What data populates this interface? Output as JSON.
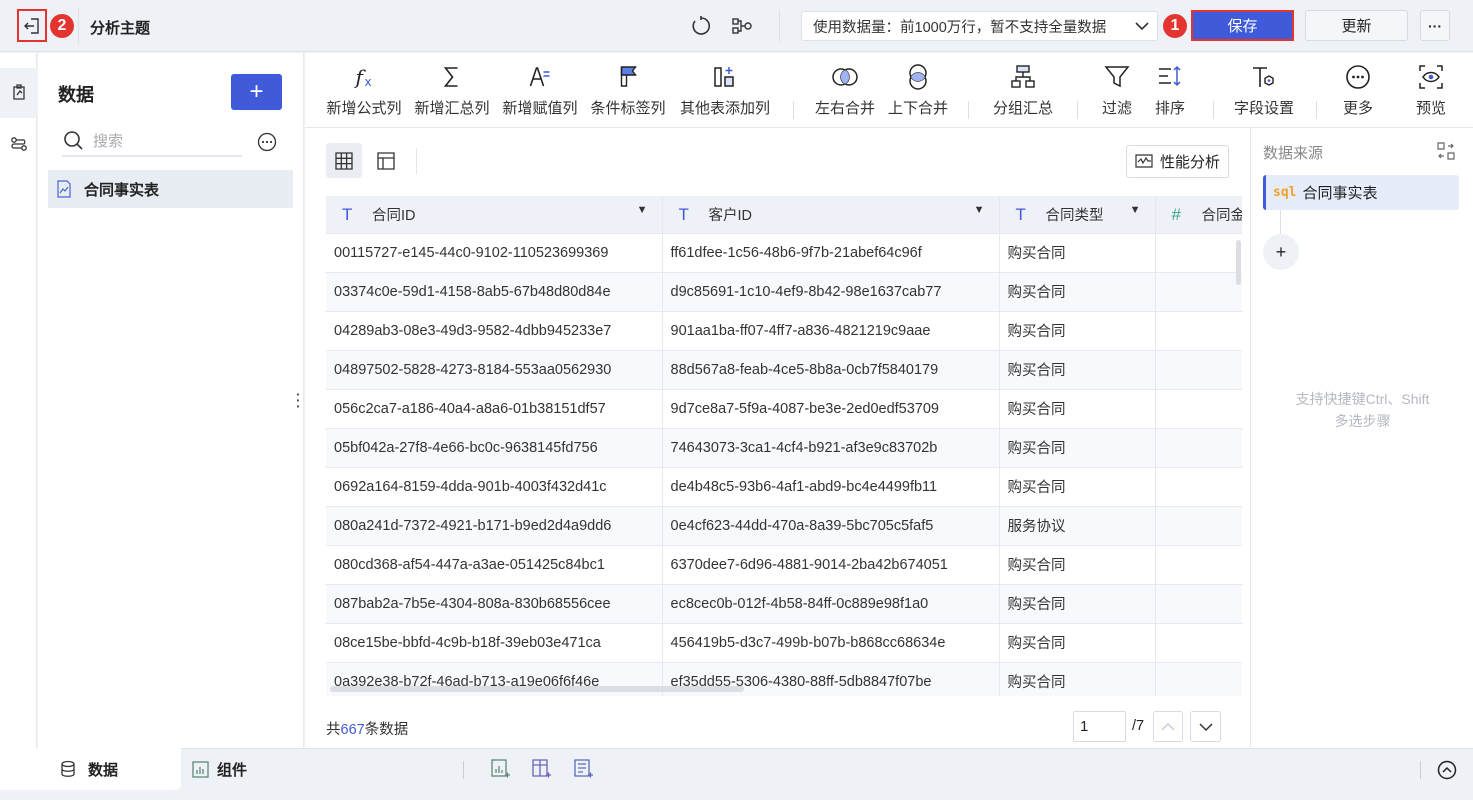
{
  "header": {
    "title": "分析主题",
    "badge_back": "2",
    "badge_save": "1",
    "data_volume": "使用数据量：前1000万行，暂不支持全量数据",
    "save": "保存",
    "update": "更新",
    "more": "···"
  },
  "left_panel": {
    "title": "数据",
    "search_placeholder": "搜索",
    "items": [
      {
        "label": "合同事实表"
      }
    ]
  },
  "toolbar": [
    {
      "label": "新增公式列",
      "icon": "formula-icon"
    },
    {
      "label": "新增汇总列",
      "icon": "sigma-icon"
    },
    {
      "label": "新增赋值列",
      "icon": "assign-icon"
    },
    {
      "label": "条件标签列",
      "icon": "flag-icon"
    },
    {
      "label": "其他表添加列",
      "icon": "add-column-icon"
    },
    {
      "label": "左右合并",
      "icon": "merge-lr-icon"
    },
    {
      "label": "上下合并",
      "icon": "merge-tb-icon"
    },
    {
      "label": "分组汇总",
      "icon": "group-icon"
    },
    {
      "label": "过滤",
      "icon": "filter-icon"
    },
    {
      "label": "排序",
      "icon": "sort-icon"
    },
    {
      "label": "字段设置",
      "icon": "field-settings-icon"
    },
    {
      "label": "更多",
      "icon": "more-icon"
    },
    {
      "label": "预览",
      "icon": "preview-icon"
    }
  ],
  "content": {
    "perf_button": "性能分析",
    "columns": [
      {
        "type": "T",
        "name": "合同ID"
      },
      {
        "type": "T",
        "name": "客户ID"
      },
      {
        "type": "T",
        "name": "合同类型"
      },
      {
        "type": "#",
        "name": "合同金"
      }
    ],
    "rows": [
      [
        "00115727-e145-44c0-9102-110523699369",
        "ff61dfee-1c56-48b6-9f7b-21abef64c96f",
        "购买合同"
      ],
      [
        "03374c0e-59d1-4158-8ab5-67b48d80d84e",
        "d9c85691-1c10-4ef9-8b42-98e1637cab77",
        "购买合同"
      ],
      [
        "04289ab3-08e3-49d3-9582-4dbb945233e7",
        "901aa1ba-ff07-4ff7-a836-4821219c9aae",
        "购买合同"
      ],
      [
        "04897502-5828-4273-8184-553aa0562930",
        "88d567a8-feab-4ce5-8b8a-0cb7f5840179",
        "购买合同"
      ],
      [
        "056c2ca7-a186-40a4-a8a6-01b38151df57",
        "9d7ce8a7-5f9a-4087-be3e-2ed0edf53709",
        "购买合同"
      ],
      [
        "05bf042a-27f8-4e66-bc0c-9638145fd756",
        "74643073-3ca1-4cf4-b921-af3e9c83702b",
        "购买合同"
      ],
      [
        "0692a164-8159-4dda-901b-4003f432d41c",
        "de4b48c5-93b6-4af1-abd9-bc4e4499fb11",
        "购买合同"
      ],
      [
        "080a241d-7372-4921-b171-b9ed2d4a9dd6",
        "0e4cf623-44dd-470a-8a39-5bc705c5faf5",
        "服务协议"
      ],
      [
        "080cd368-af54-447a-a3ae-051425c84bc1",
        "6370dee7-6d96-4881-9014-2ba42b674051",
        "购买合同"
      ],
      [
        "087bab2a-7b5e-4304-808a-830b68556cee",
        "ec8cec0b-012f-4b58-84ff-0c889e98f1a0",
        "购买合同"
      ],
      [
        "08ce15be-bbfd-4c9b-b18f-39eb03e471ca",
        "456419b5-d3c7-499b-b07b-b868cc68634e",
        "购买合同"
      ],
      [
        "0a392e38-b72f-46ad-b713-a19e06f6f46e",
        "ef35dd55-5306-4380-88ff-5db8847f07be",
        "购买合同"
      ]
    ],
    "footer": {
      "prefix": "共",
      "count": "667",
      "suffix": "条数据",
      "page": "1",
      "total_pages": "/7"
    }
  },
  "right_panel": {
    "title": "数据来源",
    "source": "合同事实表",
    "source_tag": "sql",
    "hint_line1": "支持快捷键Ctrl、Shift",
    "hint_line2": "多选步骤"
  },
  "bottom": {
    "tab_data": "数据",
    "tab_components": "组件"
  },
  "colors": {
    "accent": "#3f5bd9",
    "badge": "#e3342f"
  }
}
